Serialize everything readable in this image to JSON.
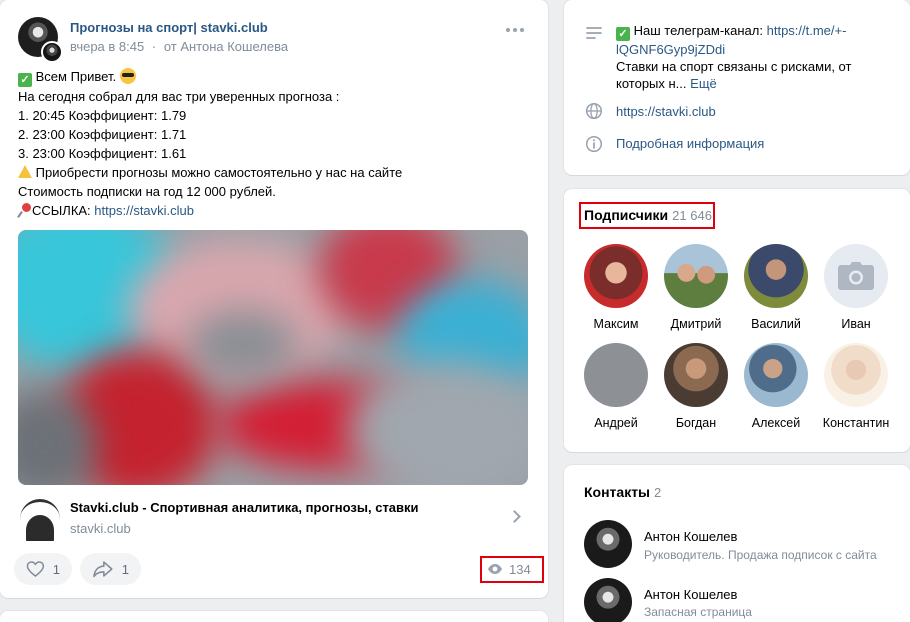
{
  "post": {
    "author": "Прогнозы на спорт| stavki.club",
    "time": "вчера в 8:45",
    "meta_sep": "·",
    "from": "от Антона Кошелева",
    "lines": {
      "greeting": "Всем Привет.",
      "l1": "На сегодня собрал для вас три уверенных прогноза :",
      "l2": "1. 20:45 Коэффициент: 1.79",
      "l3": "2. 23:00 Коэффициент: 1.71",
      "l4": "3. 23:00 Коэффициент: 1.61",
      "l5": "Приобрести прогнозы можно самостоятельно у нас на сайте",
      "l6": "Стоимость подписки на год 12 000 рублей.",
      "l7_prefix": "ССЫЛКА: ",
      "l7_link": "https://stavki.club"
    },
    "attachment": {
      "title": "Stavki.club - Спортивная аналитика, прогнозы, ставки",
      "domain": "stavki.club"
    },
    "likes": "1",
    "shares": "1",
    "views": "134",
    "icons": {
      "more": "more-dots-icon",
      "like": "heart-icon",
      "share": "share-arrow-icon",
      "views": "eye-icon"
    }
  },
  "info": {
    "telegram_prefix": "Наш телеграм-канал: ",
    "telegram_link_1": "https://t.me/+-",
    "telegram_link_2": "lQGNF6Gyp9jZDdi",
    "risk_1": "Ставки на спорт связаны с рисками, от",
    "risk_2": "которых н...",
    "more": "Ещё",
    "site": "https://stavki.club",
    "details": "Подробная информация"
  },
  "subscribers": {
    "title": "Подписчики",
    "count": "21 646",
    "people": [
      {
        "name": "Максим"
      },
      {
        "name": "Дмитрий"
      },
      {
        "name": "Василий"
      },
      {
        "name": "Иван"
      },
      {
        "name": "Андрей"
      },
      {
        "name": "Богдан"
      },
      {
        "name": "Алексей"
      },
      {
        "name": "Константин"
      }
    ]
  },
  "contacts": {
    "title": "Контакты",
    "count": "2",
    "items": [
      {
        "name": "Антон Кошелев",
        "role": "Руководитель. Продажа подписок с сайта"
      },
      {
        "name": "Антон Кошелев",
        "role": "Запасная страница"
      }
    ]
  },
  "colors": {
    "link": "#2a5885",
    "muted": "#818c99",
    "highlight_box": "#e0000b",
    "background": "#edeef0"
  }
}
